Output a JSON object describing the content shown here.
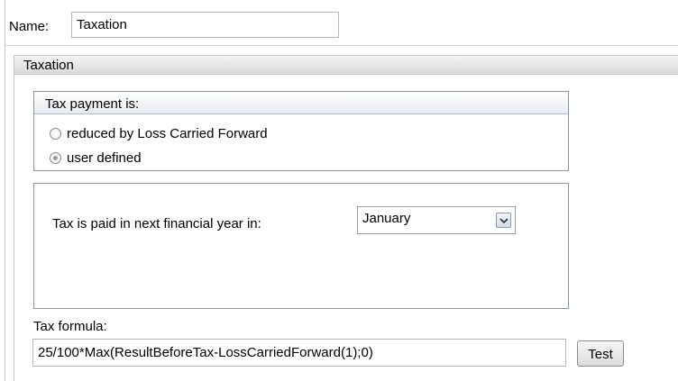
{
  "name": {
    "label": "Name:",
    "value": "Taxation"
  },
  "section": {
    "title": "Taxation"
  },
  "tax_payment": {
    "title": "Tax payment is:",
    "options": [
      {
        "label": "reduced by Loss Carried Forward",
        "selected": false
      },
      {
        "label": "user defined",
        "selected": true
      }
    ]
  },
  "schedule": {
    "label": "Tax is paid in next financial year in:",
    "selected_month": "January"
  },
  "formula": {
    "label": "Tax formula:",
    "value": "25/100*Max(ResultBeforeTax-LossCarriedForward(1);0)",
    "test_label": "Test"
  },
  "colors": {
    "group_border": "#8c97a4",
    "section_header_bg": "#dadada"
  }
}
